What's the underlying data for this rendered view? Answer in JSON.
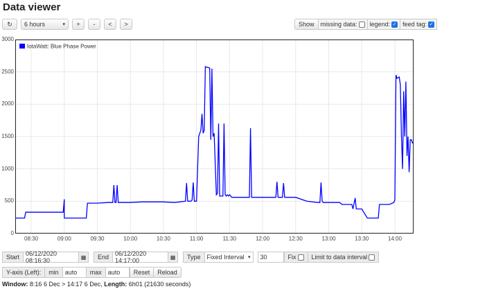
{
  "page": {
    "title": "Data viewer"
  },
  "toolbar": {
    "refresh_icon": "refresh-icon",
    "timespan": "6 hours",
    "zoom_in": "+",
    "zoom_out": "-",
    "pan_left": "<",
    "pan_right": ">"
  },
  "options": {
    "show_label": "Show",
    "missing_data": {
      "label": "missing data:",
      "checked": false
    },
    "legend": {
      "label": "legend:",
      "checked": true
    },
    "feed_tag": {
      "label": "feed tag:",
      "checked": true
    }
  },
  "chart_data": {
    "type": "line",
    "title": "",
    "series": [
      {
        "name": "IotaWatt: Blue Phase Power",
        "color": "#0000ff",
        "x": [
          "08:16",
          "08:24",
          "08:25",
          "08:50",
          "08:59",
          "09:00",
          "09:00",
          "09:01",
          "09:02",
          "09:15",
          "09:20",
          "09:21",
          "09:30",
          "09:40",
          "09:44",
          "09:45",
          "09:46",
          "09:47",
          "09:48",
          "09:49",
          "09:50",
          "10:00",
          "10:10",
          "10:20",
          "10:30",
          "10:40",
          "10:50",
          "10:51",
          "10:52",
          "10:53",
          "10:55",
          "10:56",
          "10:57",
          "10:58",
          "11:00",
          "11:02",
          "11:03",
          "11:04",
          "11:05",
          "11:06",
          "11:07",
          "11:08",
          "11:12",
          "11:13",
          "11:14",
          "11:15",
          "11:16",
          "11:18",
          "11:19",
          "11:20",
          "11:21",
          "11:24",
          "11:25",
          "11:26",
          "11:27",
          "11:28",
          "11:29",
          "11:30",
          "11:31",
          "11:32",
          "11:35",
          "11:45",
          "11:48",
          "11:49",
          "11:50",
          "11:52",
          "12:00",
          "12:12",
          "12:13",
          "12:14",
          "12:15",
          "12:18",
          "12:19",
          "12:20",
          "12:21",
          "12:30",
          "12:40",
          "12:50",
          "12:52",
          "12:53",
          "12:54",
          "12:55",
          "13:00",
          "13:10",
          "13:12",
          "13:20",
          "13:21",
          "13:22",
          "13:24",
          "13:25",
          "13:30",
          "13:35",
          "13:36",
          "13:45",
          "13:46",
          "13:55",
          "13:59",
          "14:00",
          "14:01",
          "14:02",
          "14:04",
          "14:05",
          "14:06",
          "14:07",
          "14:08",
          "14:09",
          "14:10",
          "14:11",
          "14:12",
          "14:13",
          "14:14",
          "14:15",
          "14:16",
          "14:17"
        ],
        "y": [
          240,
          240,
          330,
          330,
          330,
          530,
          240,
          240,
          240,
          240,
          240,
          470,
          470,
          480,
          480,
          750,
          480,
          480,
          750,
          480,
          480,
          480,
          490,
          490,
          490,
          480,
          500,
          780,
          500,
          500,
          500,
          520,
          790,
          500,
          500,
          1500,
          1550,
          1600,
          1850,
          1550,
          1600,
          2580,
          2560,
          1450,
          2550,
          1500,
          1550,
          600,
          620,
          1700,
          580,
          580,
          1700,
          600,
          580,
          600,
          580,
          600,
          580,
          560,
          560,
          560,
          560,
          1630,
          560,
          560,
          560,
          560,
          800,
          560,
          560,
          560,
          780,
          560,
          560,
          560,
          500,
          480,
          480,
          790,
          500,
          480,
          480,
          480,
          450,
          450,
          450,
          380,
          550,
          380,
          380,
          240,
          240,
          240,
          450,
          450,
          480,
          520,
          2450,
          2400,
          2420,
          2300,
          1500,
          1000,
          2200,
          1500,
          2350,
          1200,
          1500,
          950,
          1450,
          1450,
          1400,
          1420
        ],
        "show_in_legend": true
      }
    ],
    "xticks": [
      "08:30",
      "09:00",
      "09:30",
      "10:00",
      "10:30",
      "11:00",
      "11:30",
      "12:00",
      "12:30",
      "13:00",
      "13:30",
      "14:00"
    ],
    "ylim": [
      0,
      3000
    ],
    "yticks": [
      "0",
      "500",
      "1000",
      "1500",
      "2000",
      "2500",
      "3000"
    ],
    "grid": true,
    "legend_position": "top-left"
  },
  "controls": {
    "start_label": "Start",
    "start_value": "06/12/2020 08:16:30",
    "end_label": "End",
    "end_value": "06/12/2020 14:17:00",
    "calendar_icon": "calendar-icon",
    "type_label": "Type",
    "type_value": "Fixed Interval",
    "interval_value": "30",
    "fix_label": "Fix",
    "fix_checked": false,
    "limit_label": "Limit to data interval",
    "limit_checked": false,
    "yaxis_label": "Y-axis (Left):",
    "min_label": "min",
    "min_value": "auto",
    "max_label": "max",
    "max_value": "auto",
    "reset_label": "Reset",
    "reload_label": "Reload"
  },
  "window_info": {
    "window_label": "Window:",
    "window_value": "8:16 6 Dec > 14:17 6 Dec,",
    "length_label": "Length:",
    "length_value": "6h01 (21630 seconds)"
  }
}
